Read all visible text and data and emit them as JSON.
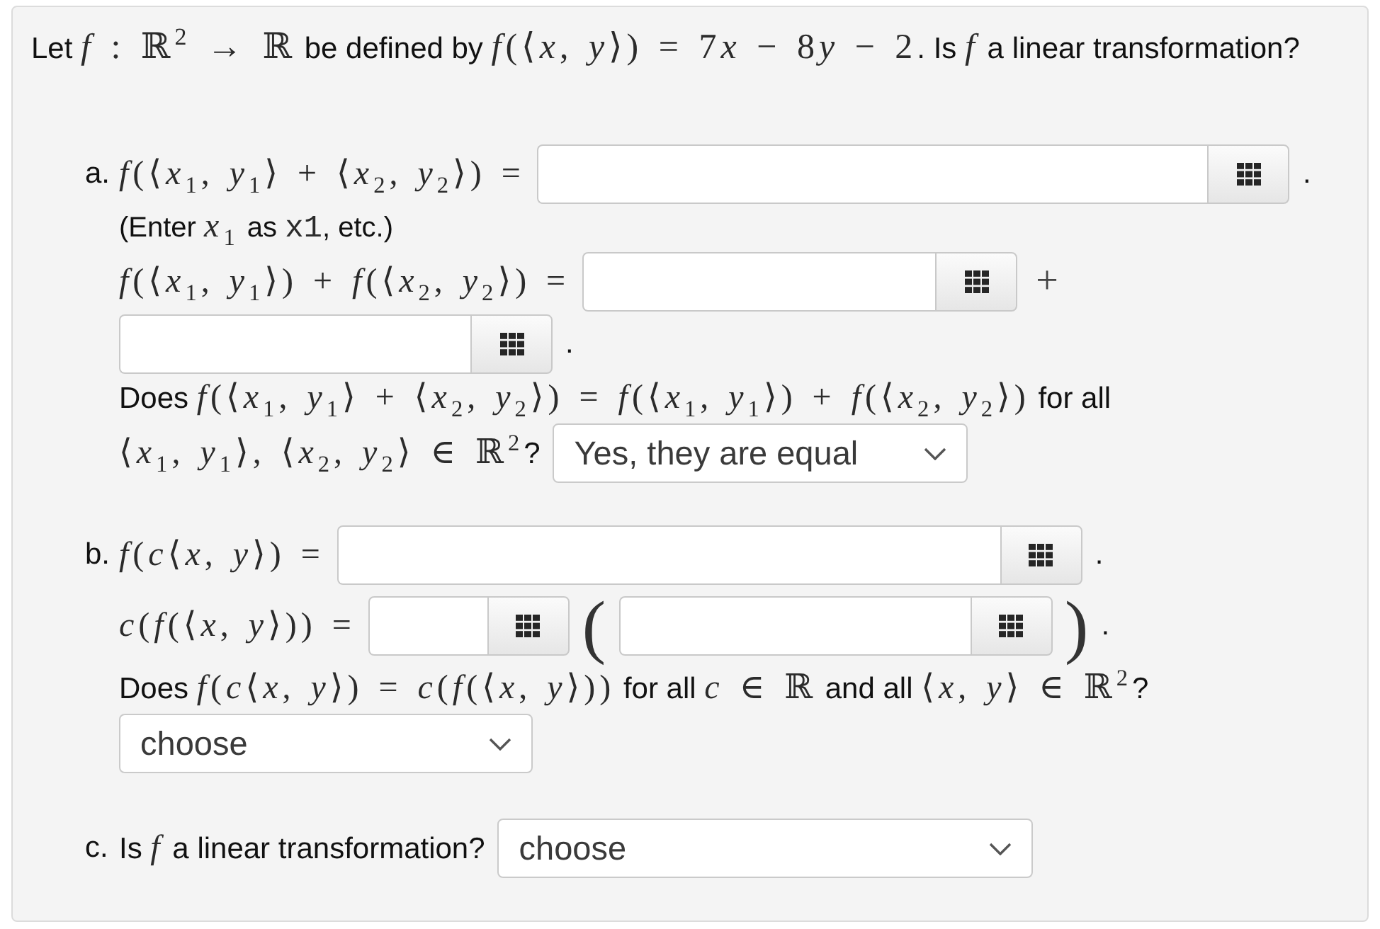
{
  "question": {
    "segments": [
      {
        "kind": "text",
        "text": "Let "
      },
      {
        "kind": "math",
        "text": "*f* : ℝ$^{2}$ → ℝ"
      },
      {
        "kind": "text",
        "text": " be defined by "
      },
      {
        "kind": "math",
        "text": "*f*(⟨*x*, *y*⟩) = 7"
      },
      {
        "kind": "math",
        "text": "*x* − 8"
      },
      {
        "kind": "math",
        "text": "*y* − 2"
      },
      {
        "kind": "text",
        "text": ". Is "
      },
      {
        "kind": "math",
        "text": "*f*"
      },
      {
        "kind": "text",
        "text": " a linear transformation?"
      }
    ]
  },
  "parts": [
    {
      "label": "a.",
      "rows": [
        [
          {
            "kind": "formula",
            "segments": [
              {
                "kind": "math",
                "text": "*f*(⟨*x*$_{1}$, *y*$_{1}$⟩ + ⟨*x*$_{2}$, *y*$_{2}$⟩) ="
              }
            ]
          },
          {
            "kind": "field"
          },
          {
            "kind": "period",
            "text": "."
          }
        ],
        [
          {
            "kind": "hint",
            "segments": [
              {
                "kind": "text",
                "text": "(Enter "
              },
              {
                "kind": "math",
                "text": "*x*$_{1}$"
              },
              {
                "kind": "text",
                "text": " as "
              },
              {
                "kind": "code",
                "text": "x1"
              },
              {
                "kind": "text",
                "text": ", etc.)"
              }
            ]
          }
        ],
        [
          {
            "kind": "formula",
            "segments": [
              {
                "kind": "math",
                "text": "*f*(⟨*x*$_{1}$, *y*$_{1}$⟩) + *f*(⟨*x*$_{2}$, *y*$_{2}$⟩) ="
              }
            ]
          },
          {
            "kind": "field"
          },
          {
            "kind": "operator",
            "text": "+"
          }
        ],
        [
          {
            "kind": "field"
          },
          {
            "kind": "period",
            "text": "."
          }
        ],
        [
          {
            "kind": "sentence",
            "segments": [
              {
                "kind": "text",
                "text": "Does "
              },
              {
                "kind": "math",
                "text": "*f*(⟨*x*$_{1}$, *y*$_{1}$⟩ + ⟨*x*$_{2}$, *y*$_{2}$⟩) = *f*(⟨*x*$_{1}$, *y*$_{1}$⟩) + *f*(⟨*x*$_{2}$, *y*$_{2}$⟩)"
              },
              {
                "kind": "text",
                "text": " for all"
              }
            ]
          }
        ],
        [
          {
            "kind": "sentence",
            "segments": [
              {
                "kind": "math",
                "text": "⟨*x*$_{1}$, *y*$_{1}$⟩, ⟨*x*$_{2}$, *y*$_{2}$⟩ ∈ ℝ$^{2}$"
              },
              {
                "kind": "text",
                "text": "?"
              }
            ]
          },
          {
            "kind": "select",
            "value": "Yes, they are equal"
          }
        ]
      ]
    },
    {
      "label": "b.",
      "rows": [
        [
          {
            "kind": "formula",
            "segments": [
              {
                "kind": "math",
                "text": "*f*(*c*⟨*x*, *y*⟩) ="
              }
            ]
          },
          {
            "kind": "field"
          },
          {
            "kind": "period",
            "text": "."
          }
        ],
        [
          {
            "kind": "formula",
            "segments": [
              {
                "kind": "math",
                "text": "*c*(*f*(⟨*x*, *y*⟩)) ="
              }
            ]
          },
          {
            "kind": "field"
          },
          {
            "kind": "paren",
            "text": "("
          },
          {
            "kind": "field"
          },
          {
            "kind": "paren",
            "text": ")"
          },
          {
            "kind": "period",
            "text": "."
          }
        ],
        [
          {
            "kind": "sentence",
            "segments": [
              {
                "kind": "text",
                "text": "Does "
              },
              {
                "kind": "math",
                "text": "*f*(*c*⟨*x*, *y*⟩) = *c*(*f*(⟨*x*, *y*⟩))"
              },
              {
                "kind": "text",
                "text": " for all "
              },
              {
                "kind": "math",
                "text": "*c* ∈ ℝ"
              },
              {
                "kind": "text",
                "text": " and all "
              },
              {
                "kind": "math",
                "text": "⟨*x*, *y*⟩ ∈ ℝ$^{2}$"
              },
              {
                "kind": "text",
                "text": "?"
              }
            ]
          }
        ],
        [
          {
            "kind": "select",
            "value": "choose"
          }
        ]
      ]
    },
    {
      "label": "c.",
      "rows": [
        [
          {
            "kind": "sentence",
            "segments": [
              {
                "kind": "text",
                "text": "Is "
              },
              {
                "kind": "math",
                "text": "*f*"
              },
              {
                "kind": "text",
                "text": " a linear transformation?"
              }
            ]
          },
          {
            "kind": "select",
            "value": "choose"
          }
        ]
      ]
    }
  ]
}
